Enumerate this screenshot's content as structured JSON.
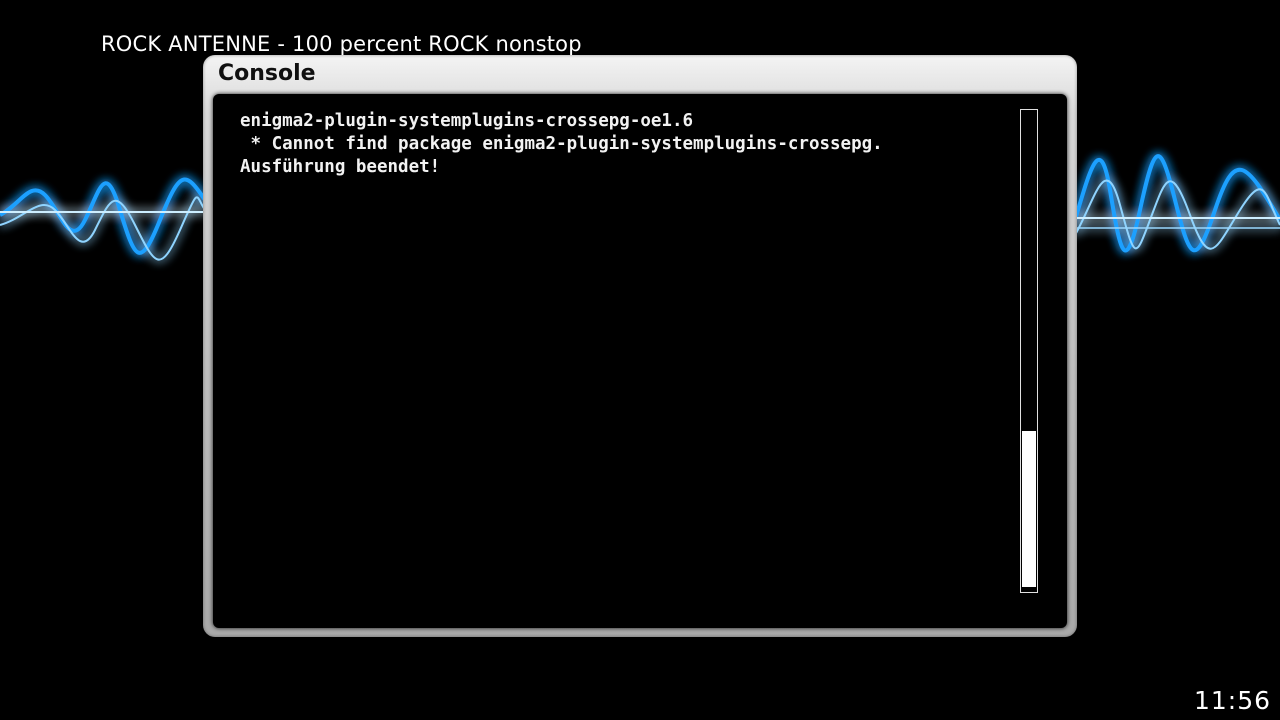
{
  "header": {
    "now_playing": "ROCK ANTENNE - 100 percent ROCK nonstop"
  },
  "console": {
    "title": "Console",
    "lines": [
      "enigma2-plugin-systemplugins-crossepg-oe1.6",
      " * Cannot find package enigma2-plugin-systemplugins-crossepg.",
      "Ausführung beendet!"
    ],
    "scroll": {
      "thumb_start_fraction": 0.665,
      "thumb_end_fraction": 0.99
    }
  },
  "clock": {
    "time": "11:56"
  },
  "background": {
    "decoration": "blue-sound-wave",
    "colors": {
      "glow": "#1ea0ff",
      "line": "#bfe6ff",
      "base": "#000000"
    }
  }
}
